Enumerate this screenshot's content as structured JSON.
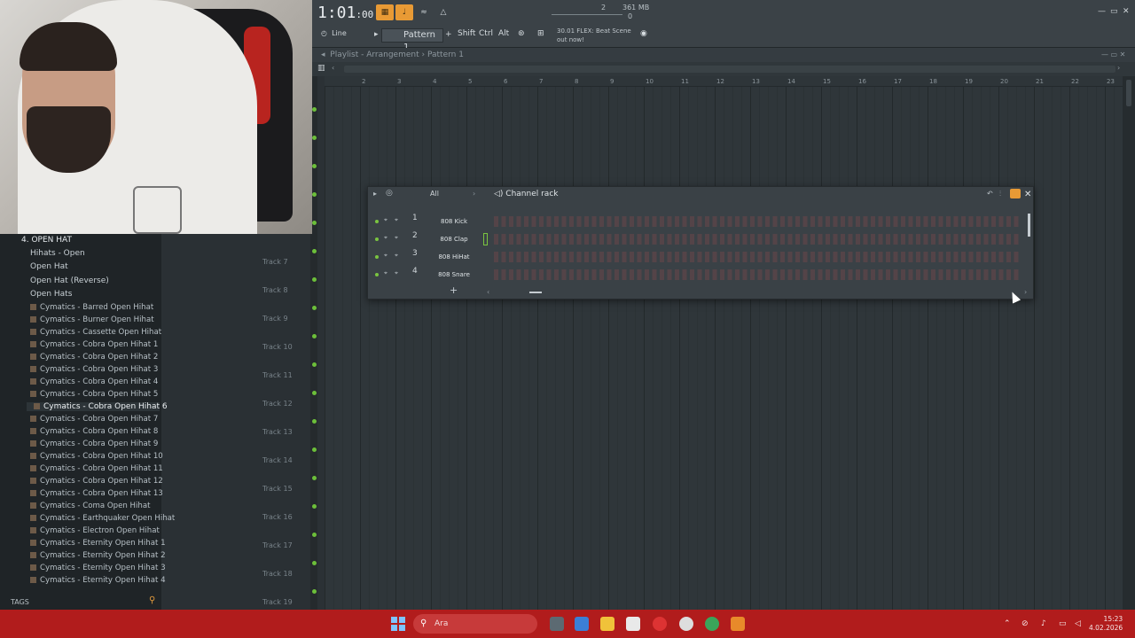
{
  "transport": {
    "time": "1:01",
    "time_small": ":00",
    "mem1": "361 MB",
    "mem2": "0",
    "counter": "2"
  },
  "toolbar": {
    "line_mode": "Line",
    "pattern": "Pattern 1",
    "keys": [
      "Shift",
      "Ctrl",
      "Alt"
    ],
    "news": "30.01 FLEX: Beat Scene out now!"
  },
  "playlist": {
    "title": "Playlist - Arrangement",
    "pattern": "Pattern 1",
    "ruler": [
      "2",
      "3",
      "4",
      "5",
      "6",
      "7",
      "8",
      "9",
      "10",
      "11",
      "12",
      "13",
      "14",
      "15",
      "16",
      "17",
      "18",
      "19",
      "20",
      "21",
      "22",
      "23"
    ]
  },
  "browser": {
    "folder": "4. OPEN HAT",
    "subfolders": [
      "Hihats - Open",
      "Open Hat",
      "Open Hat (Reverse)",
      "Open Hats"
    ],
    "files": [
      "Cymatics - Barred Open Hihat",
      "Cymatics - Burner Open Hihat",
      "Cymatics - Cassette Open Hihat",
      "Cymatics - Cobra Open Hihat 1",
      "Cymatics - Cobra Open Hihat 2",
      "Cymatics - Cobra Open Hihat 3",
      "Cymatics - Cobra Open Hihat 4",
      "Cymatics - Cobra Open Hihat 5",
      "Cymatics - Cobra Open Hihat 6",
      "Cymatics - Cobra Open Hihat 7",
      "Cymatics - Cobra Open Hihat 8",
      "Cymatics - Cobra Open Hihat 9",
      "Cymatics - Cobra Open Hihat 10",
      "Cymatics - Cobra Open Hihat 11",
      "Cymatics - Cobra Open Hihat 12",
      "Cymatics - Cobra Open Hihat 13",
      "Cymatics - Coma Open Hihat",
      "Cymatics - Earthquaker Open Hihat",
      "Cymatics - Electron Open Hihat",
      "Cymatics - Eternity Open Hihat 1",
      "Cymatics - Eternity Open Hihat 2",
      "Cymatics - Eternity Open Hihat 3",
      "Cymatics - Eternity Open Hihat 4"
    ],
    "selected_index": 8,
    "tags_label": "TAGS"
  },
  "tracks": [
    "Track 7",
    "Track 8",
    "Track 9",
    "Track 10",
    "Track 11",
    "Track 12",
    "Track 13",
    "Track 14",
    "Track 15",
    "Track 16",
    "Track 17",
    "Track 18",
    "Track 19"
  ],
  "channel_rack": {
    "title": "Channel rack",
    "filter": "All",
    "channels": [
      {
        "num": "1",
        "name": "808 Kick"
      },
      {
        "num": "2",
        "name": "808 Clap"
      },
      {
        "num": "3",
        "name": "808 HiHat"
      },
      {
        "num": "4",
        "name": "808 Snare"
      }
    ]
  },
  "taskbar": {
    "search": "Ara",
    "time": "15:23",
    "date": "4.02.2026"
  }
}
